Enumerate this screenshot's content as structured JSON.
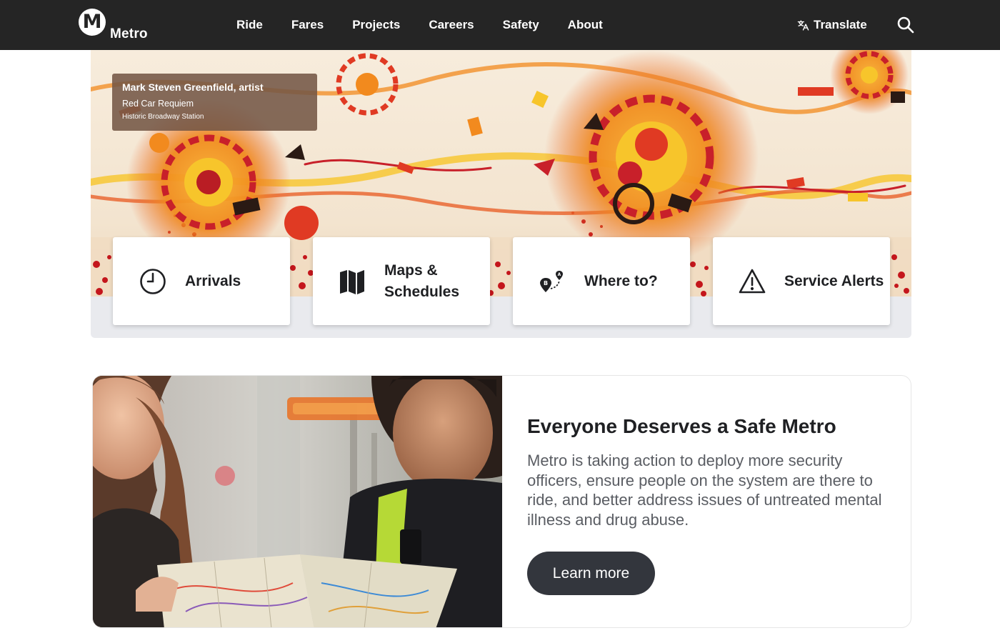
{
  "header": {
    "logo_mark": "M",
    "logo_text": "Metro",
    "nav": [
      "Ride",
      "Fares",
      "Projects",
      "Careers",
      "Safety",
      "About"
    ],
    "translate_label": "Translate",
    "search_icon": "search-icon",
    "translate_icon": "translate-icon"
  },
  "hero": {
    "caption": {
      "artist": "Mark Steven Greenfield, artist",
      "title": "Red Car Requiem",
      "station": "Historic Broadway Station"
    },
    "quick_links": [
      {
        "label": "Arrivals",
        "icon": "clock-icon"
      },
      {
        "label": "Maps & Schedules",
        "icon": "map-icon"
      },
      {
        "label": "Where to?",
        "icon": "route-pin-icon"
      },
      {
        "label": "Service Alerts",
        "icon": "warning-icon"
      }
    ],
    "route_icon_letters": [
      "B",
      "A"
    ]
  },
  "feature": {
    "title": "Everyone Deserves a Safe Metro",
    "body": "Metro is taking action to deploy more security officers, ensure people on the system are there to ride, and better address issues of untreated mental illness and drug abuse.",
    "button_label": "Learn more"
  },
  "colors": {
    "header_bg": "#252525",
    "button_bg": "#33363d",
    "hero_tray": "#e9eaee",
    "art_orange": "#f28a1e",
    "art_red": "#c8202a",
    "art_yellow": "#f7c52b"
  }
}
